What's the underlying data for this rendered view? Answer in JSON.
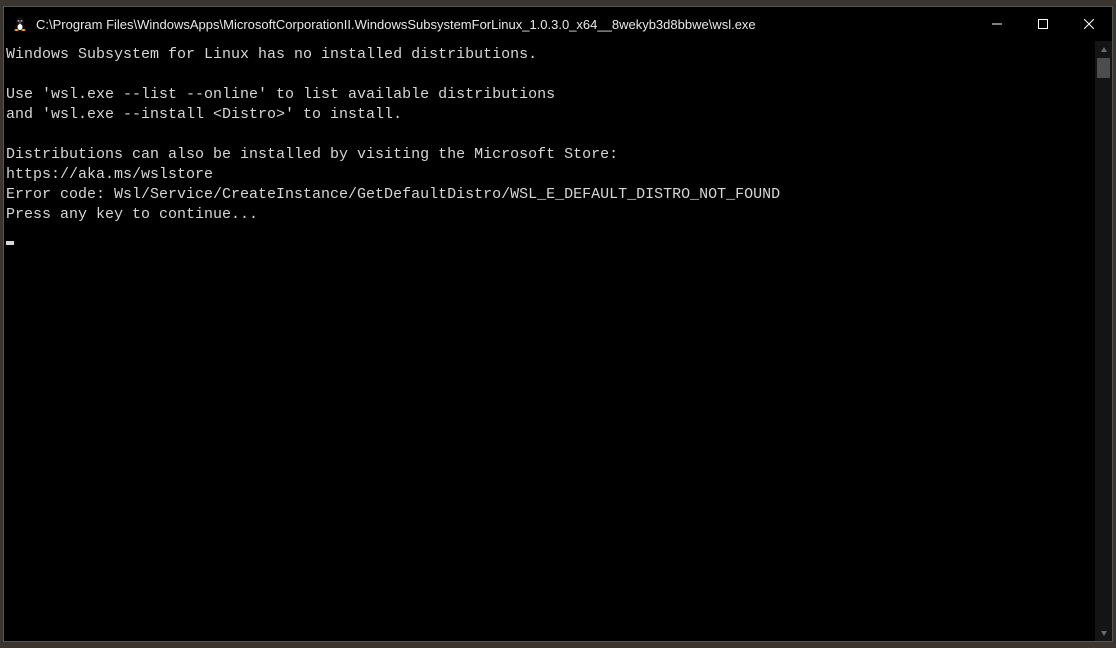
{
  "window": {
    "title": "C:\\Program Files\\WindowsApps\\MicrosoftCorporationII.WindowsSubsystemForLinux_1.0.3.0_x64__8wekyb3d8bbwe\\wsl.exe"
  },
  "terminal": {
    "lines": [
      "Windows Subsystem for Linux has no installed distributions.",
      "",
      "Use 'wsl.exe --list --online' to list available distributions",
      "and 'wsl.exe --install <Distro>' to install.",
      "",
      "Distributions can also be installed by visiting the Microsoft Store:",
      "https://aka.ms/wslstore",
      "Error code: Wsl/Service/CreateInstance/GetDefaultDistro/WSL_E_DEFAULT_DISTRO_NOT_FOUND",
      "Press any key to continue..."
    ]
  }
}
